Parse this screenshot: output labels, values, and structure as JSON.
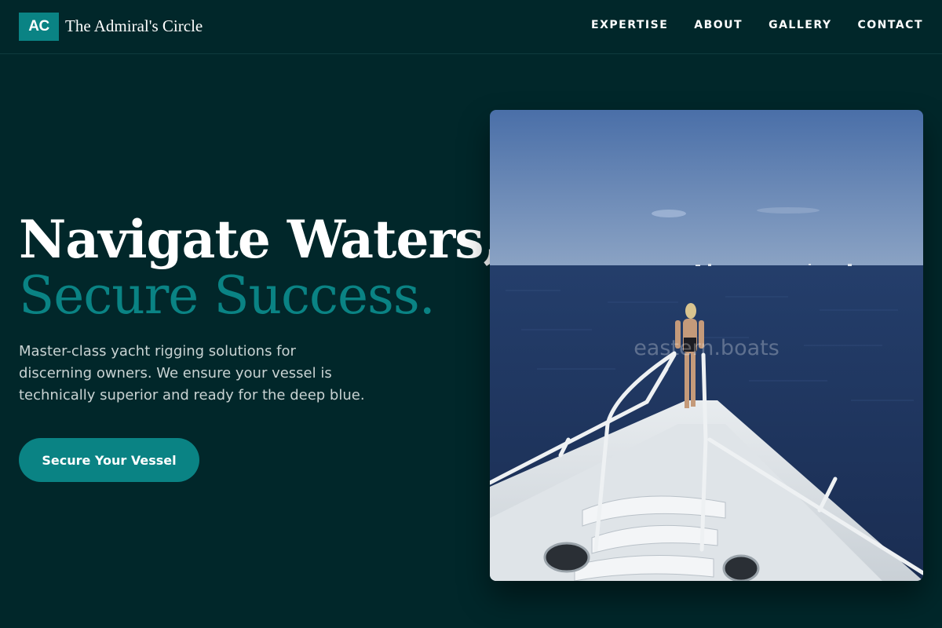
{
  "header": {
    "logo_initials": "AC",
    "brand_name": "The Admiral's Circle",
    "nav": [
      "EXPERTISE",
      "ABOUT",
      "GALLERY",
      "CONTACT"
    ]
  },
  "hero": {
    "title_line1": "Navigate Waters,",
    "title_line2": "Secure Success.",
    "description": "Master-class yacht rigging solutions for discerning owners. We ensure your vessel is technically superior and ready for the deep blue.",
    "cta_label": "Secure Your Vessel",
    "image_watermark": "eastern.boats"
  },
  "colors": {
    "background": "#01272a",
    "accent": "#0a8384",
    "text": "#ffffff",
    "muted_text": "#c9d3d3"
  }
}
